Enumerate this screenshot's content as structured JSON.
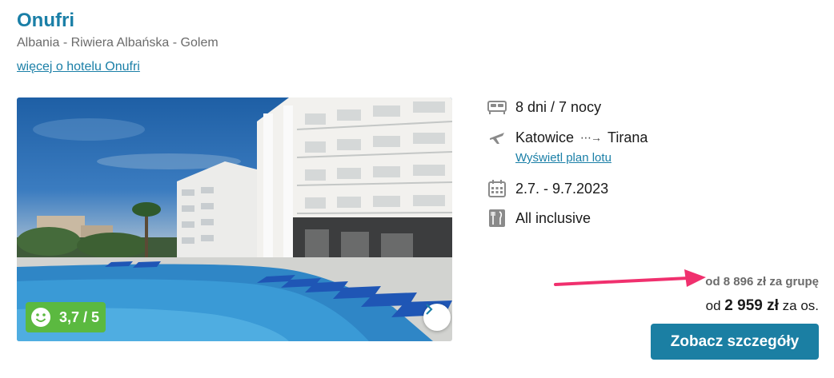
{
  "hotel": {
    "name": "Onufri",
    "location": "Albania - Riwiera Albańska - Golem",
    "more_link": "więcej o hotelu Onufri"
  },
  "photo": {
    "rating": "3,7 / 5",
    "icons": {
      "next": "chevron-right-icon",
      "rating": "smiley-icon"
    }
  },
  "details": {
    "duration": "8 dni / 7 nocy",
    "flight_from": "Katowice",
    "flight_arrow": "⋯→",
    "flight_to": "Tirana",
    "flight_plan_link": "Wyświetl plan lotu",
    "dates": "2.7. - 9.7.2023",
    "board": "All inclusive",
    "icons": {
      "duration": "bed-icon",
      "flight": "plane-icon",
      "dates": "calendar-icon",
      "board": "cutlery-icon"
    }
  },
  "price": {
    "group_text": "od 8 896 zł za grupę",
    "person_prefix": "od",
    "person_amount": "2 959 zł",
    "person_suffix": "za os.",
    "button_label": "Zobacz szczegóły"
  },
  "colors": {
    "brand": "#1a7fa7",
    "button": "#1b7fa3",
    "rating_badge": "#5bb940",
    "annotation_arrow": "#f0306e"
  }
}
